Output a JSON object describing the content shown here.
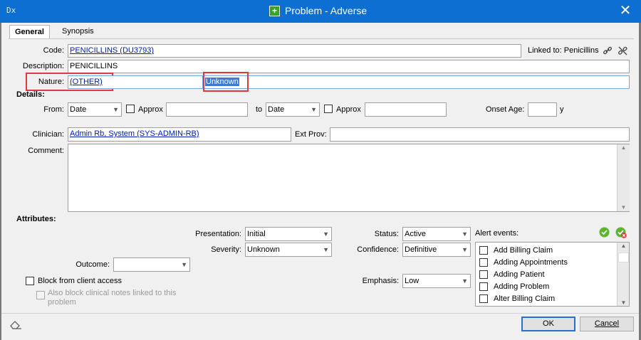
{
  "window": {
    "app_label": "Dx",
    "title": "Problem - Adverse",
    "close_glyph": "✕"
  },
  "tabs": [
    {
      "label": "General"
    },
    {
      "label": "Synopsis"
    }
  ],
  "code": {
    "label": "Code:",
    "value": "PENICILLINS (DU3793)"
  },
  "linked_to": "Linked to: Penicillins",
  "description": {
    "label": "Description:",
    "value": "PENICILLINS"
  },
  "nature": {
    "label": "Nature:",
    "value": "(OTHER)",
    "extra_value": "Unknown"
  },
  "details": {
    "heading": "Details:",
    "from_label": "From:",
    "from_value": "Date",
    "approx_label": "Approx",
    "to_label": "to",
    "to_value": "Date",
    "approx2_label": "Approx",
    "onset_age_label": "Onset Age:",
    "onset_age_unit": "y",
    "clinician_label": "Clinician:",
    "clinician_value": "Admin Rb, System (SYS-ADMIN-RB)",
    "ext_prov_label": "Ext Prov:",
    "comment_label": "Comment:"
  },
  "attributes": {
    "heading": "Attributes:",
    "presentation_label": "Presentation:",
    "presentation_value": "Initial",
    "severity_label": "Severity:",
    "severity_value": "Unknown",
    "outcome_label": "Outcome:",
    "outcome_value": "",
    "status_label": "Status:",
    "status_value": "Active",
    "confidence_label": "Confidence:",
    "confidence_value": "Definitive",
    "emphasis_label": "Emphasis:",
    "emphasis_value": "Low",
    "block_label": "Block from client access",
    "also_block_label": "Also block clinical notes linked to this problem"
  },
  "alert_events": {
    "label": "Alert events:",
    "items": [
      "Add Billing Claim",
      "Adding Appointments",
      "Adding Patient",
      "Adding Problem",
      "Alter Billing Claim"
    ]
  },
  "footer": {
    "ok_label": "OK",
    "cancel_label": "Cancel"
  },
  "colors": {
    "title_bar": "#0d6fd1",
    "highlight_box": "#e03b3b",
    "link": "#0020b0",
    "selection": "#3a7bd5"
  }
}
